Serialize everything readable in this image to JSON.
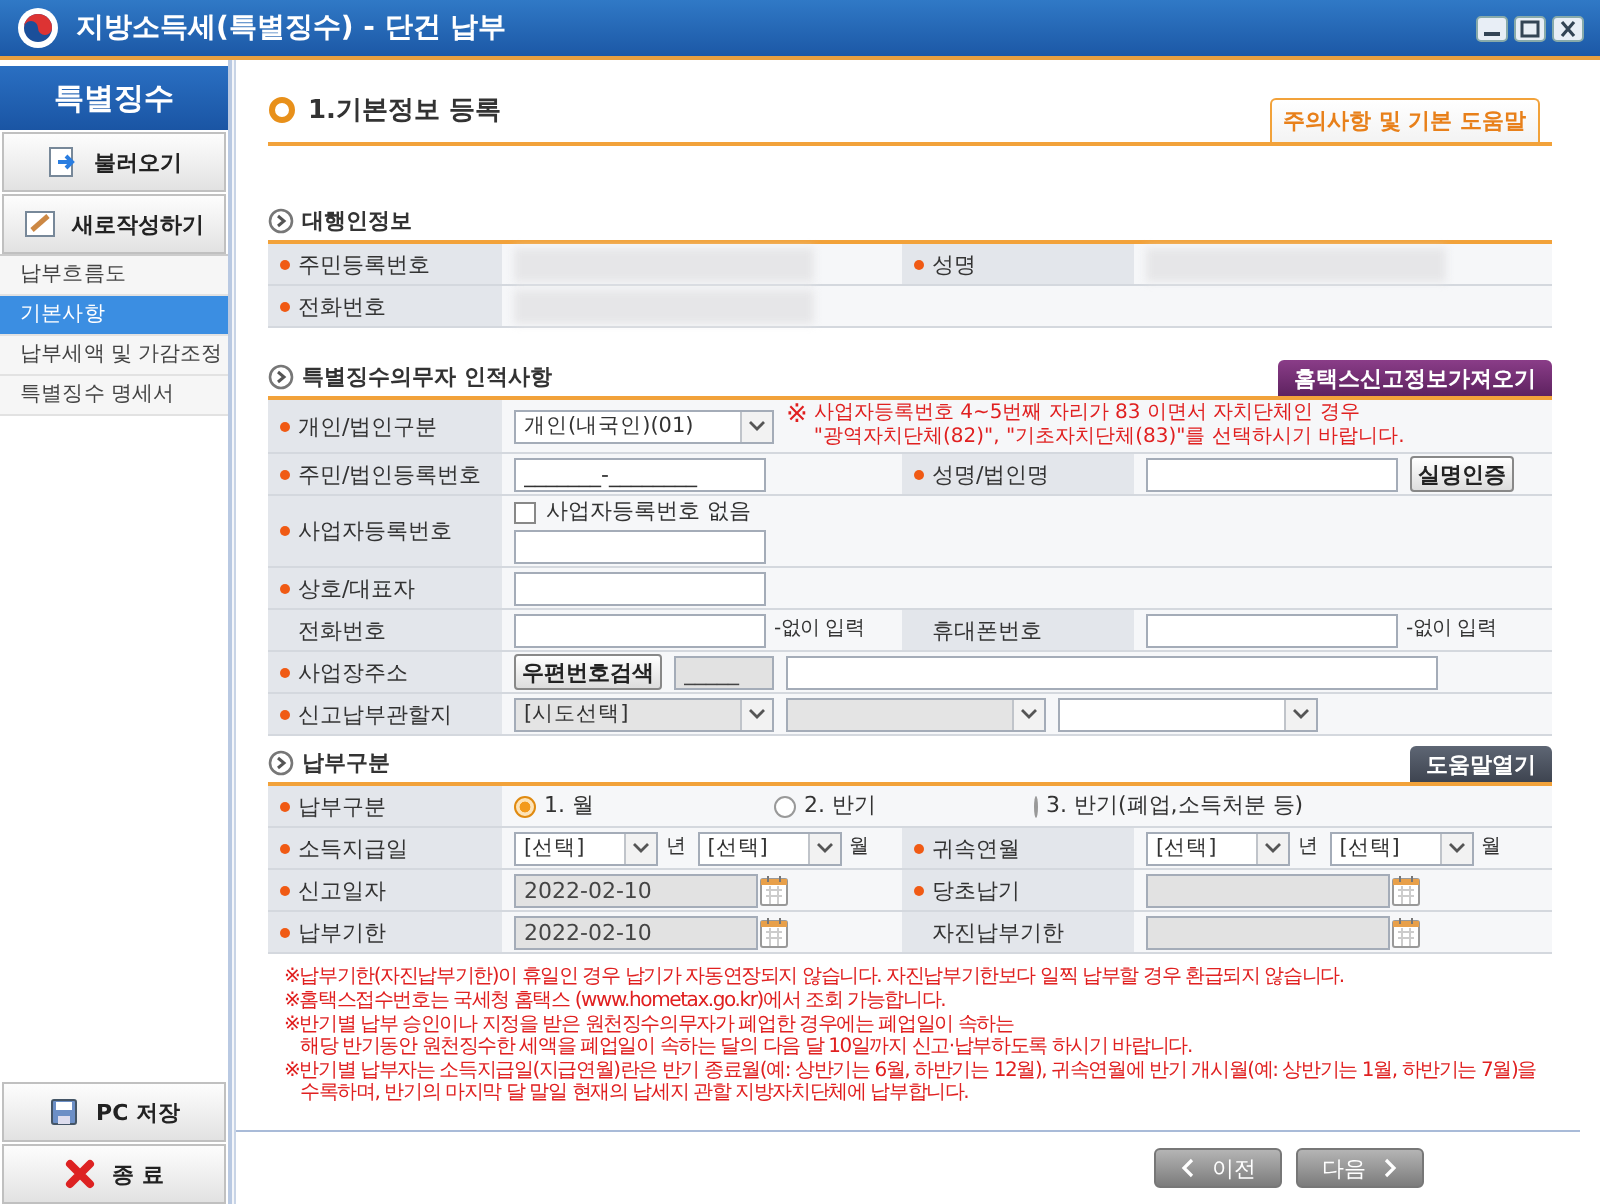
{
  "window": {
    "title": "지방소득세(특별징수) - 단건 납부"
  },
  "sidebar": {
    "title": "특별징수",
    "actions": [
      {
        "label": "불러오기",
        "kind": "load"
      },
      {
        "label": "새로작성하기",
        "kind": "new"
      }
    ],
    "items": [
      {
        "label": "납부흐름도",
        "selected": false
      },
      {
        "label": "기본사항",
        "selected": true
      },
      {
        "label": "납부세액 및 가감조정",
        "selected": false
      },
      {
        "label": "특별징수 명세서",
        "selected": false
      }
    ],
    "footer_actions": [
      {
        "label": "PC 저장",
        "kind": "save"
      },
      {
        "label": "종 료",
        "kind": "exit"
      }
    ]
  },
  "page": {
    "title": "1.기본정보 등록",
    "help_tab": "주의사항 및 기본 도움말"
  },
  "sections": [
    {
      "title": "대행인정보",
      "rows": [
        {
          "fields": [
            {
              "label": "주민등록번호",
              "required": true,
              "controls": [
                {
                  "kind": "redacted"
                }
              ]
            },
            {
              "label": "성명",
              "required": true,
              "controls": [
                {
                  "kind": "redacted"
                }
              ]
            }
          ]
        },
        {
          "fields": [
            {
              "label": "전화번호",
              "required": true,
              "controls": [
                {
                  "kind": "redacted"
                }
              ]
            }
          ]
        }
      ]
    },
    {
      "title": "특별징수의무자 인적사항",
      "action": {
        "label": "홈택스신고정보가져오기",
        "kind": "import"
      },
      "rows": [
        {
          "fields": [
            {
              "label": "개인/법인구분",
              "required": true,
              "controls": [
                {
                  "kind": "select",
                  "value": "개인(내국인)(01)",
                  "disabled": false
                },
                {
                  "kind": "note",
                  "mark": "※",
                  "lines": [
                    "사업자등록번호 4~5번째 자리가 83 이면서 자치단체인 경우",
                    "\"광역자치단체(82)\", \"기초자치단체(83)\"를 선택하시기 바랍니다."
                  ]
                }
              ]
            }
          ]
        },
        {
          "fields": [
            {
              "label": "주민/법인등록번호",
              "required": true,
              "controls": [
                {
                  "kind": "input",
                  "value": "_______-________",
                  "disabled": false
                }
              ]
            },
            {
              "label": "성명/법인명",
              "required": true,
              "controls": [
                {
                  "kind": "input",
                  "disabled": false
                },
                {
                  "kind": "button",
                  "label": "실명인증"
                }
              ]
            }
          ]
        },
        {
          "fields": [
            {
              "label": "사업자등록번호",
              "required": true,
              "controls": [
                {
                  "kind": "checkbox",
                  "label": "사업자등록번호 없음",
                  "checked": false
                },
                {
                  "kind": "input",
                  "disabled": false
                }
              ]
            }
          ]
        },
        {
          "fields": [
            {
              "label": "상호/대표자",
              "required": true,
              "controls": [
                {
                  "kind": "input",
                  "disabled": false
                }
              ]
            }
          ]
        },
        {
          "fields": [
            {
              "label": "전화번호",
              "required": false,
              "controls": [
                {
                  "kind": "input",
                  "disabled": false
                },
                {
                  "kind": "text",
                  "text": "-없이 입력"
                }
              ]
            },
            {
              "label": "휴대폰번호",
              "required": false,
              "controls": [
                {
                  "kind": "input",
                  "disabled": false
                },
                {
                  "kind": "text",
                  "text": "-없이 입력"
                }
              ]
            }
          ]
        },
        {
          "fields": [
            {
              "label": "사업장주소",
              "required": true,
              "controls": [
                {
                  "kind": "button",
                  "label": "우편번호검색"
                },
                {
                  "kind": "zipcode",
                  "value": "_____",
                  "disabled": true
                },
                {
                  "kind": "input",
                  "disabled": false
                }
              ]
            }
          ]
        },
        {
          "fields": [
            {
              "label": "신고납부관할지",
              "required": true,
              "controls": [
                {
                  "kind": "select",
                  "value": "[시도선택]",
                  "disabled": true
                },
                {
                  "kind": "select",
                  "disabled": true
                },
                {
                  "kind": "select",
                  "disabled": false
                }
              ]
            }
          ]
        }
      ]
    },
    {
      "title": "납부구분",
      "action": {
        "label": "도움말열기",
        "kind": "help"
      },
      "rows": [
        {
          "fields": [
            {
              "label": "납부구분",
              "required": true,
              "controls": [
                {
                  "kind": "radio",
                  "label": "1. 월",
                  "selected": true
                },
                {
                  "kind": "radio",
                  "label": "2. 반기",
                  "selected": false
                },
                {
                  "kind": "radio",
                  "label": "3. 반기(폐업,소득처분 등)",
                  "selected": false
                }
              ]
            }
          ]
        },
        {
          "fields": [
            {
              "label": "소득지급일",
              "required": true,
              "controls": [
                {
                  "kind": "select",
                  "value": "[선택]",
                  "disabled": false
                },
                {
                  "kind": "text",
                  "text": "년"
                },
                {
                  "kind": "select",
                  "value": "[선택]",
                  "disabled": false
                },
                {
                  "kind": "text",
                  "text": "월"
                }
              ]
            },
            {
              "label": "귀속연월",
              "required": true,
              "controls": [
                {
                  "kind": "select",
                  "value": "[선택]",
                  "disabled": false
                },
                {
                  "kind": "text",
                  "text": "년"
                },
                {
                  "kind": "select",
                  "value": "[선택]",
                  "disabled": false
                },
                {
                  "kind": "text",
                  "text": "월"
                }
              ]
            }
          ]
        },
        {
          "fields": [
            {
              "label": "신고일자",
              "required": true,
              "controls": [
                {
                  "kind": "date",
                  "value": "2022-02-10",
                  "disabled": true
                }
              ]
            },
            {
              "label": "당초납기",
              "required": true,
              "controls": [
                {
                  "kind": "date",
                  "disabled": true
                }
              ]
            }
          ]
        },
        {
          "fields": [
            {
              "label": "납부기한",
              "required": true,
              "controls": [
                {
                  "kind": "date",
                  "value": "2022-02-10",
                  "disabled": true
                }
              ]
            },
            {
              "label": "자진납부기한",
              "required": false,
              "controls": [
                {
                  "kind": "date",
                  "disabled": true
                }
              ]
            }
          ]
        }
      ]
    }
  ],
  "notes": [
    {
      "lines": [
        "※납부기한(자진납부기한)이 휴일인 경우 납기가 자동연장되지 않습니다. 자진납부기한보다 일찍 납부할 경우 환급되지 않습니다."
      ]
    },
    {
      "lines": [
        "※홈택스접수번호는 국세청 홈택스 (www.hometax.go.kr)에서 조회 가능합니다."
      ]
    },
    {
      "lines": [
        "※반기별 납부 승인이나 지정을 받은 원천징수의무자가 폐업한 경우에는 폐업일이 속하는",
        "해당 반기동안 원천징수한 세액을 폐업일이 속하는 달의 다음 달 10일까지 신고·납부하도록 하시기 바랍니다."
      ]
    },
    {
      "lines": [
        "※반기별 납부자는 소득지급일(지급연월)란은 반기 종료월(예: 상반기는 6월, 하반기는 12월), 귀속연월에 반기 개시월(예: 상반기는 1월, 하반기는 7월)을",
        "수록하며, 반기의 마지막 달 말일 현재의 납세지 관할 지방자치단체에 납부합니다."
      ]
    }
  ],
  "nav": [
    {
      "label": "이전",
      "kind": "prev"
    },
    {
      "label": "다음",
      "kind": "next"
    }
  ]
}
